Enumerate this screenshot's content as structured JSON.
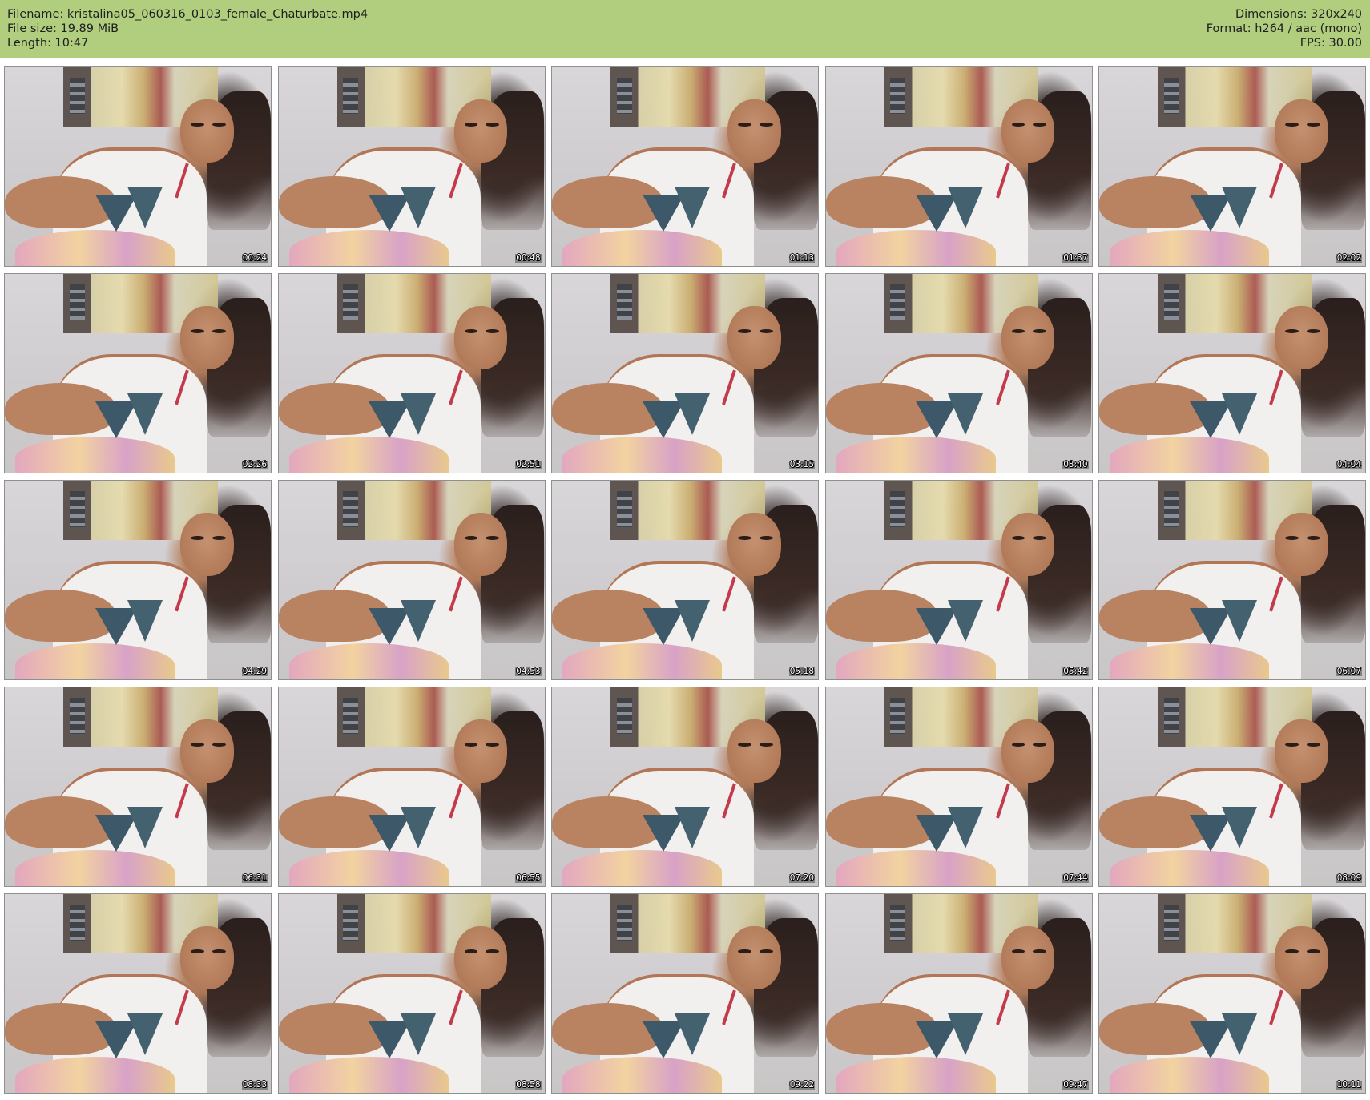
{
  "header": {
    "filename_line": "Filename: kristalina05_060316_0103_female_Chaturbate.mp4",
    "filesize_line": "File size: 19.89 MiB",
    "length_line": "Length: 10:47",
    "dimensions_line": "Dimensions: 320x240",
    "format_line": "Format: h264 / aac (mono)",
    "fps_line": "FPS: 30.00"
  },
  "colors": {
    "header_bg": "#b1ce7f",
    "timestamp_text": "#ffffff"
  },
  "thumbnails": [
    {
      "time": "00:24"
    },
    {
      "time": "00:48"
    },
    {
      "time": "01:13"
    },
    {
      "time": "01:37"
    },
    {
      "time": "02:02"
    },
    {
      "time": "02:26"
    },
    {
      "time": "02:51"
    },
    {
      "time": "03:15"
    },
    {
      "time": "03:40"
    },
    {
      "time": "04:04"
    },
    {
      "time": "04:29"
    },
    {
      "time": "04:53"
    },
    {
      "time": "05:18"
    },
    {
      "time": "05:42"
    },
    {
      "time": "06:07"
    },
    {
      "time": "06:31"
    },
    {
      "time": "06:55"
    },
    {
      "time": "07:20"
    },
    {
      "time": "07:44"
    },
    {
      "time": "08:09"
    },
    {
      "time": "08:33"
    },
    {
      "time": "08:58"
    },
    {
      "time": "09:22"
    },
    {
      "time": "09:47"
    },
    {
      "time": "10:11"
    }
  ]
}
